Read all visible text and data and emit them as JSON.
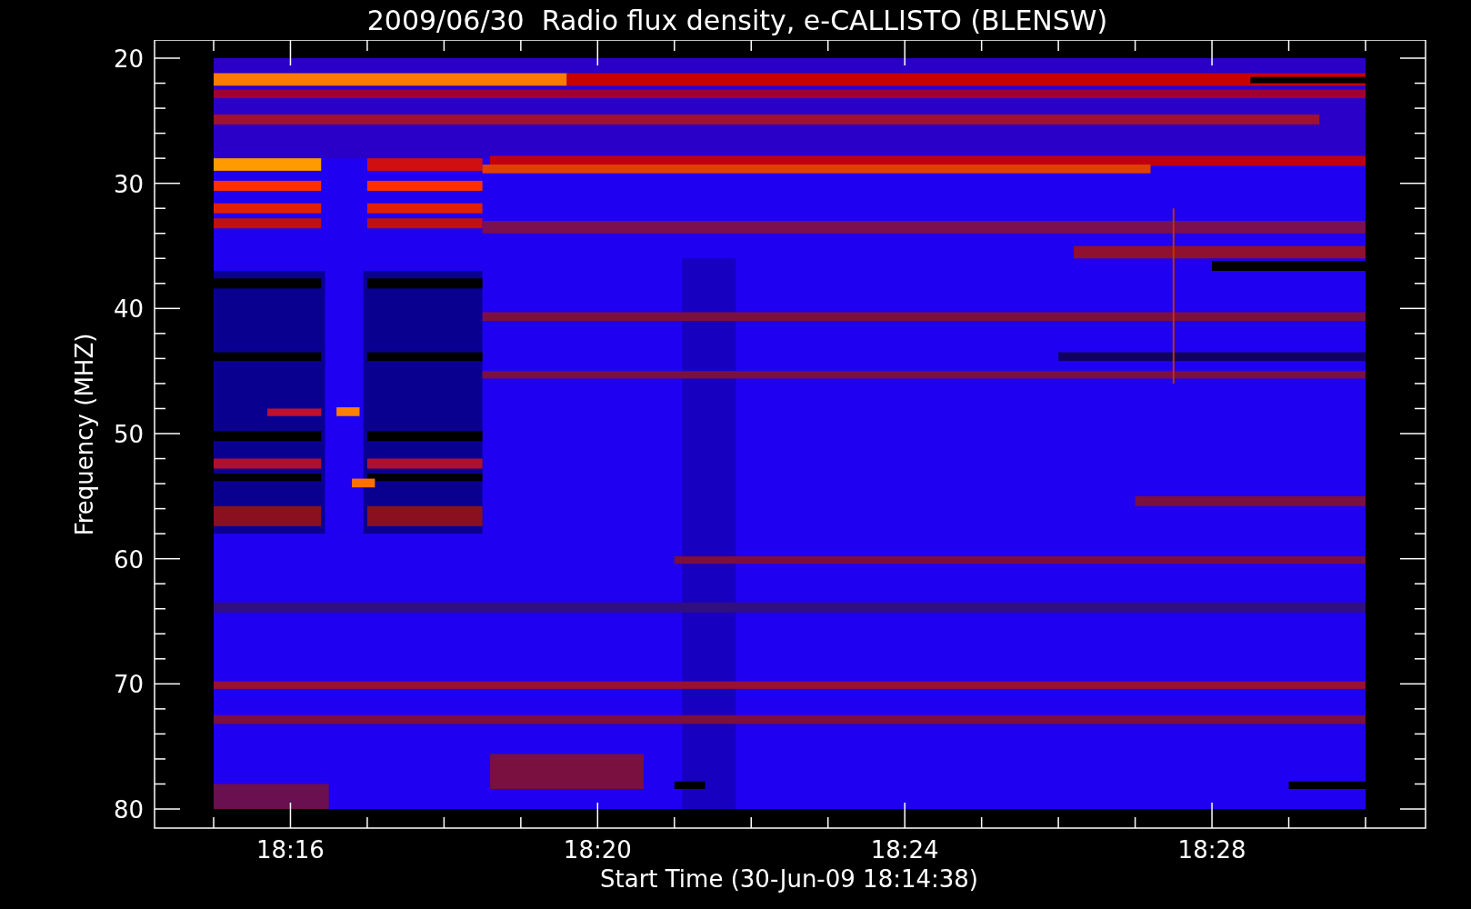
{
  "title": "2009/06/30  Radio flux density, e-CALLISTO (BLENSW)",
  "plot": {
    "y_axis": {
      "label": "Frequency (MHZ)",
      "ticks": [
        "20",
        "30",
        "40",
        "50",
        "60",
        "70",
        "80"
      ]
    },
    "x_axis": {
      "label": "Start Time (30-Jun-09 18:14:38)",
      "ticks": [
        "18:16",
        "18:20",
        "18:24",
        "18:28"
      ]
    }
  }
}
